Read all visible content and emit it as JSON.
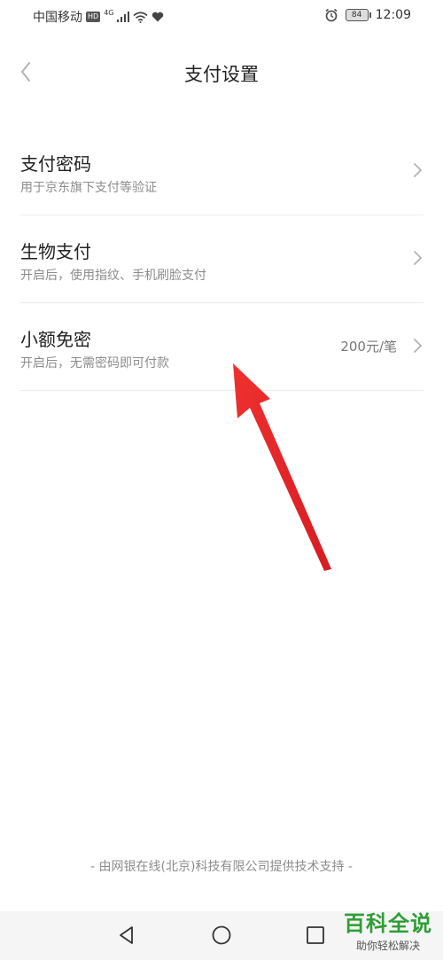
{
  "status_bar": {
    "carrier": "中国移动",
    "hd_badge": "HD",
    "network": "4G",
    "battery": "84",
    "time": "12:09"
  },
  "header": {
    "title": "支付设置"
  },
  "settings": [
    {
      "title": "支付密码",
      "subtitle": "用于京东旗下支付等验证",
      "value": ""
    },
    {
      "title": "生物支付",
      "subtitle": "开启后，使用指纹、手机刷脸支付",
      "value": ""
    },
    {
      "title": "小额免密",
      "subtitle": "开启后，无需密码即可付款",
      "value": "200元/笔"
    }
  ],
  "footer": {
    "text": "- 由网银在线(北京)科技有限公司提供技术支持 -"
  },
  "watermark": {
    "title": "百科全说",
    "subtitle": "助你轻松解决"
  },
  "colors": {
    "annotation_arrow": "#e8262b",
    "watermark_green": "#2e9e35"
  }
}
